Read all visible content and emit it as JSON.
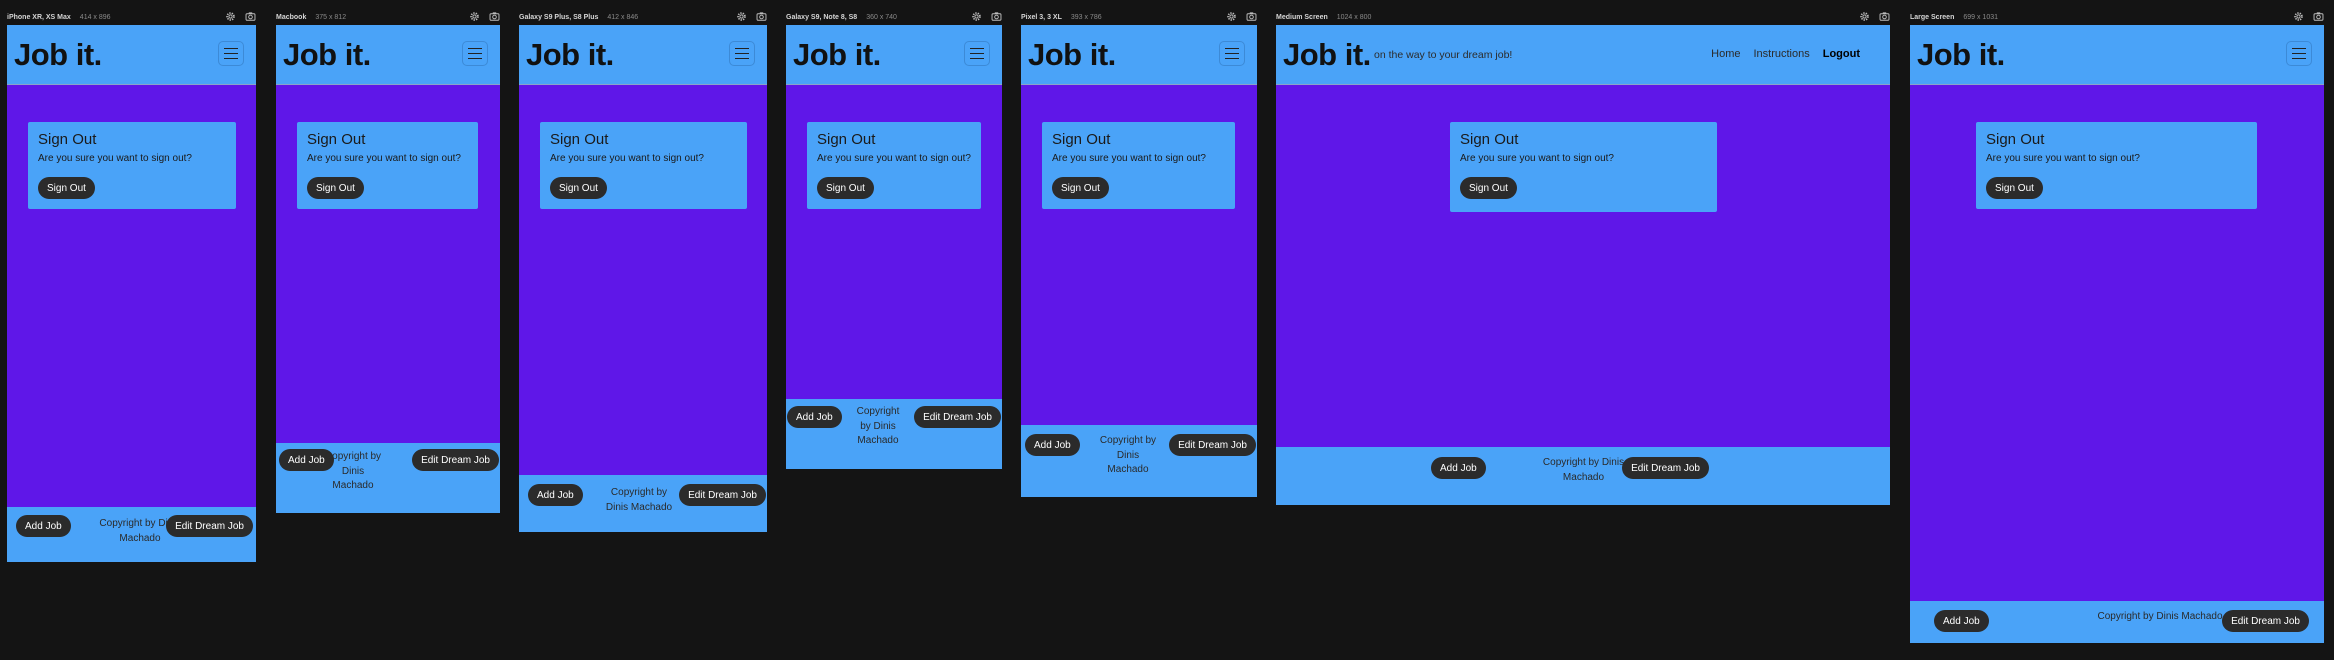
{
  "app": {
    "brand": "Job it.",
    "tagline": "on the way to your dream job!"
  },
  "nav": {
    "home": "Home",
    "instructions": "Instructions",
    "logout": "Logout"
  },
  "signout": {
    "title": "Sign Out",
    "prompt": "Are you sure you want to sign out?",
    "button": "Sign Out"
  },
  "footer": {
    "add_job": "Add Job",
    "copyright": "Copyright by Dinis Machado",
    "edit_dream_job": "Edit Dream Job"
  },
  "devices": [
    {
      "name": "iPhone XR, XS Max",
      "size": "414 x 896"
    },
    {
      "name": "Macbook",
      "size": "375 x 812"
    },
    {
      "name": "Galaxy S9 Plus, S8 Plus",
      "size": "412 x 846"
    },
    {
      "name": "Galaxy S9, Note 8, S8",
      "size": "360 x 740"
    },
    {
      "name": "Pixel 3, 3 XL",
      "size": "393 x 786"
    },
    {
      "name": "Medium Screen",
      "size": "1024 x 800"
    },
    {
      "name": "Large Screen",
      "size": "699 x 1031"
    }
  ],
  "icons": [
    "gear-icon",
    "camera-icon",
    "hamburger-menu-icon"
  ],
  "colors": {
    "header_footer": "#4aa3f8",
    "body": "#5f17e8",
    "button": "#2b2b2b",
    "backdrop": "#141414"
  }
}
